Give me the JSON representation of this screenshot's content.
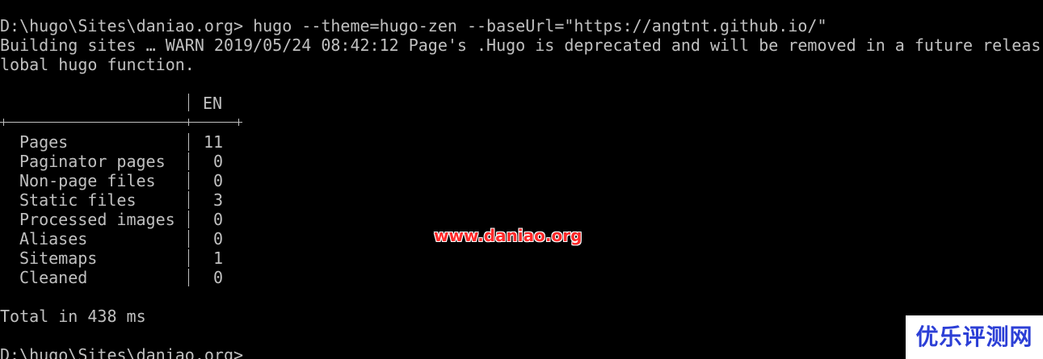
{
  "colors": {
    "background": "#000000",
    "foreground": "#c0c0c0",
    "watermark_red": "#ff2a2a",
    "logo_blue": "#2c3fd6"
  },
  "terminal": {
    "command_line": "D:\\hugo\\Sites\\daniao.org> hugo --theme=hugo-zen --baseUrl=\"https://angtnt.github.io/\"",
    "warn_line_1": "Building sites … WARN 2019/05/24 08:42:12 Page's .Hugo is deprecated and will be removed in a future releas",
    "warn_line_2": "lobal hugo function.",
    "stats_table": {
      "column_header": "EN",
      "rows": [
        {
          "label": "Pages",
          "value": "11"
        },
        {
          "label": "Paginator pages",
          "value": "0"
        },
        {
          "label": "Non-page files",
          "value": "0"
        },
        {
          "label": "Static files",
          "value": "3"
        },
        {
          "label": "Processed images",
          "value": "0"
        },
        {
          "label": "Aliases",
          "value": "0"
        },
        {
          "label": "Sitemaps",
          "value": "1"
        },
        {
          "label": "Cleaned",
          "value": "0"
        }
      ]
    },
    "total_line": "Total in 438 ms",
    "prompt_line": "D:\\hugo\\Sites\\daniao.org>"
  },
  "watermark": {
    "url": "www.daniao.org",
    "logo_text": "优乐评测网"
  }
}
